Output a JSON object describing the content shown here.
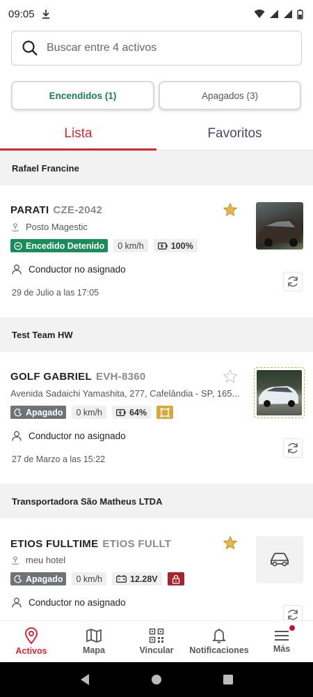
{
  "status": {
    "time": "09:05"
  },
  "search": {
    "placeholder": "Buscar entre 4 activos"
  },
  "filters": {
    "on_label": "Encendidos (1)",
    "off_label": "Apagados (3)"
  },
  "tabs": [
    {
      "label": "Lista"
    },
    {
      "label": "Favoritos"
    }
  ],
  "groups": [
    {
      "name": "Rafael Francine",
      "vehicle": {
        "name": "PARATI",
        "plate": "CZE-2042",
        "location": "Posto Magestic",
        "status": "Encedido Detenido",
        "speed": "0 km/h",
        "battery": "100%",
        "driver": "Conductor no asignado",
        "date": "29 de Julio a las 17:05",
        "favorite": true
      }
    },
    {
      "name": "Test Team HW",
      "vehicle": {
        "name": "GOLF GABRIEL",
        "plate": "EVH-8360",
        "location": "Avenida Sadaichi Yamashita, 277, Cafelândia - SP, 165...",
        "status": "Apagado",
        "speed": "0 km/h",
        "battery": "64%",
        "driver": "Conductor no asignado",
        "date": "27 de Marzo a las 15:22",
        "favorite": false
      }
    },
    {
      "name": "Transportadora São Matheus LTDA",
      "vehicle": {
        "name": "ETIOS FULLTIME",
        "plate": "ETIOS FULLT",
        "location": "meu hotel",
        "status": "Apagado",
        "speed": "0 km/h",
        "voltage": "12.28V",
        "driver": "Conductor no asignado",
        "favorite": true
      }
    }
  ],
  "nav": [
    {
      "label": "Activos",
      "icon": "location-pin-icon"
    },
    {
      "label": "Mapa",
      "icon": "map-icon"
    },
    {
      "label": "Vincular",
      "icon": "qr-code-icon"
    },
    {
      "label": "Notificaciones",
      "icon": "bell-icon"
    },
    {
      "label": "Más",
      "icon": "menu-icon"
    }
  ],
  "colors": {
    "accent": "#d6262f",
    "on_green": "#1a8c5a",
    "off_gray": "#6e7378",
    "star": "#e8b64c",
    "lock_red": "#a8232e"
  }
}
